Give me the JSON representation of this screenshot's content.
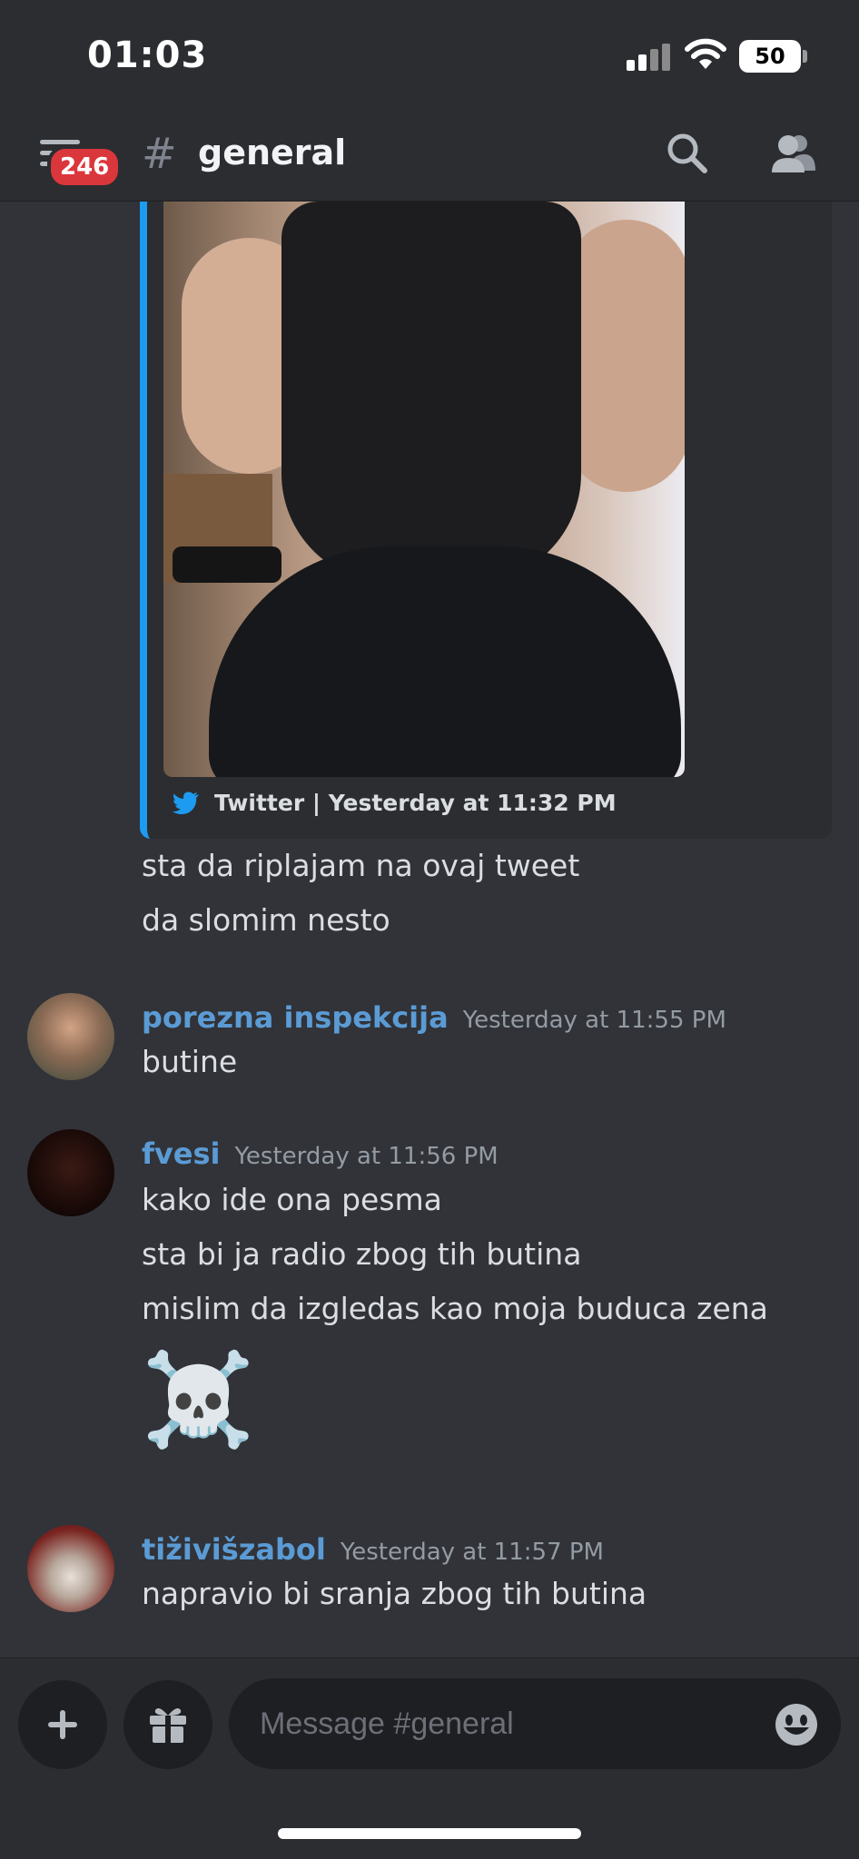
{
  "status_bar": {
    "time": "01:03",
    "battery": "50"
  },
  "header": {
    "badge_count": "246",
    "hash": "#",
    "channel": "general"
  },
  "embed": {
    "footer_source": "Twitter | Yesterday at 11:32 PM"
  },
  "messages": {
    "cont1": "sta da riplajam na ovaj tweet",
    "cont2": "da slomim nesto",
    "m1": {
      "author": "porezna inspekcija",
      "time": "Yesterday at 11:55 PM",
      "lines": [
        "butine"
      ]
    },
    "m2": {
      "author": "fvesi",
      "time": "Yesterday at 11:56 PM",
      "lines": [
        "kako ide ona pesma",
        "sta bi ja radio zbog tih butina",
        "mislim da izgledas kao moja buduca zena"
      ],
      "emoji": "☠️"
    },
    "m3": {
      "author": "tiživišzabol",
      "time": "Yesterday at 11:57 PM",
      "lines": [
        "napravio bi sranja zbog tih butina"
      ]
    }
  },
  "input": {
    "placeholder": "Message #general"
  },
  "colors": {
    "background": "#313338",
    "bars": "#2b2d31",
    "username": "#5b9bd5",
    "twitter": "#1d9bf0",
    "badge": "#da373c"
  }
}
